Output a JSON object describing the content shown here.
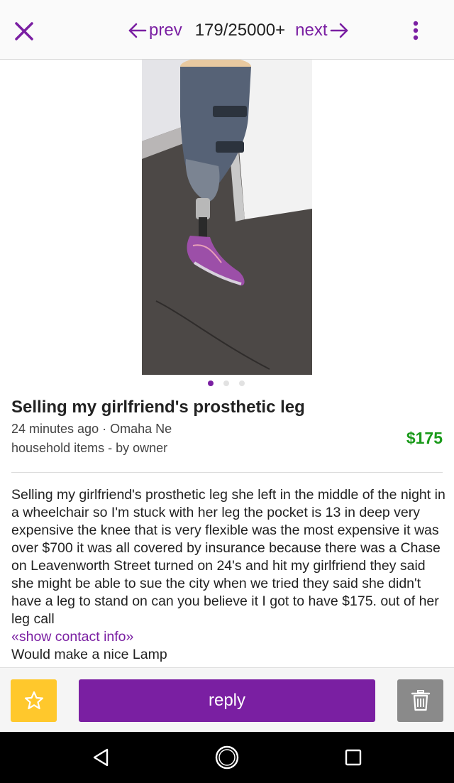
{
  "header": {
    "close_icon": "close-icon",
    "prev_label": "prev",
    "counter": "179/25000+",
    "next_label": "next",
    "menu_icon": "more-vert-icon"
  },
  "gallery": {
    "image_count": 3,
    "active_index": 0
  },
  "listing": {
    "title": "Selling my girlfriend's prosthetic leg",
    "posted": "24 minutes ago",
    "separator": "·",
    "location": "Omaha Ne",
    "category": "household items - by owner",
    "price": "$175",
    "body": "Selling my girlfriend's prosthetic leg she left in the middle of the night in a wheelchair so I'm stuck with her leg the pocket is 13 in deep very expensive the knee that is very flexible was the most expensive it was over $700 it was all covered by insurance because there was a Chase on Leavenworth Street turned on 24's and hit my girlfriend they said she might be able to sue the city when we tried they said she didn't have a leg to stand on can you believe it I got to have $175. out of her leg call",
    "contact_link": "«show contact info»",
    "body_end": "Would make a nice Lamp"
  },
  "actions": {
    "favorite_icon": "star-icon",
    "reply_label": "reply",
    "trash_icon": "trash-icon"
  },
  "system_nav": {
    "back_icon": "back-triangle-icon",
    "home_icon": "home-circle-icon",
    "recents_icon": "recents-square-icon"
  },
  "colors": {
    "accent": "#7a1fa2",
    "price": "#1a9a1a",
    "favorite": "#ffc82c",
    "trash": "#8a8a8a"
  }
}
